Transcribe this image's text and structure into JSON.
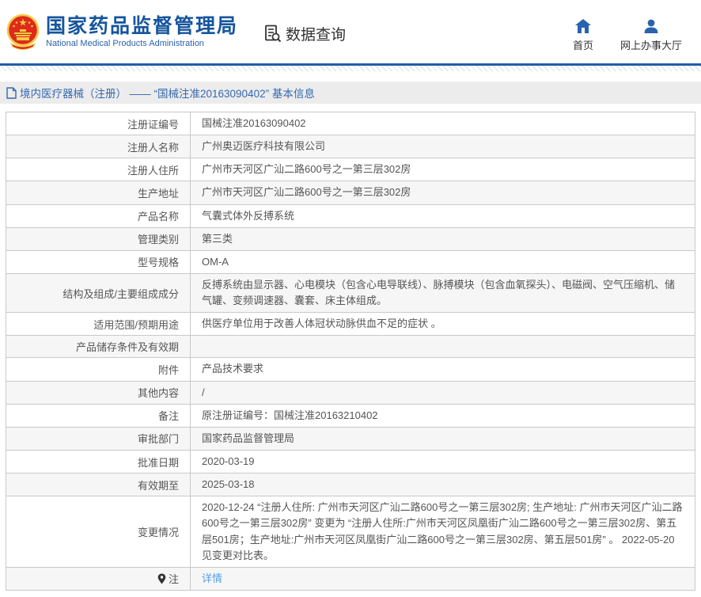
{
  "header": {
    "org_name_cn": "国家药品监督管理局",
    "org_name_en": "National Medical Products Administration",
    "section_title": "数据查询",
    "nav": [
      {
        "label": "首页",
        "icon": "home-icon"
      },
      {
        "label": "网上办事大厅",
        "icon": "user-icon"
      }
    ]
  },
  "breadcrumb": {
    "icon": "document-icon",
    "text": "境内医疗器械（注册） —— “国械注准20163090402” 基本信息"
  },
  "table": {
    "rows": [
      {
        "label": "注册证编号",
        "value": "国械注准20163090402"
      },
      {
        "label": "注册人名称",
        "value": "广州奥迈医疗科技有限公司"
      },
      {
        "label": "注册人住所",
        "value": "广州市天河区广汕二路600号之一第三层302房"
      },
      {
        "label": "生产地址",
        "value": "广州市天河区广汕二路600号之一第三层302房"
      },
      {
        "label": "产品名称",
        "value": "气囊式体外反搏系统"
      },
      {
        "label": "管理类别",
        "value": "第三类"
      },
      {
        "label": "型号规格",
        "value": "OM-A"
      },
      {
        "label": "结构及组成/主要组成成分",
        "value": "反搏系统由显示器、心电模块（包含心电导联线）、脉搏模块（包含血氧探头）、电磁阀、空气压缩机、储 气罐、变频调速器、囊套、床主体组成。"
      },
      {
        "label": "适用范围/预期用途",
        "value": "供医疗单位用于改善人体冠状动脉供血不足的症状 。"
      },
      {
        "label": "产品储存条件及有效期",
        "value": ""
      },
      {
        "label": "附件",
        "value": "产品技术要求"
      },
      {
        "label": "其他内容",
        "value": "/"
      },
      {
        "label": "备注",
        "value": "原注册证编号：国械注准20163210402"
      },
      {
        "label": "审批部门",
        "value": "国家药品监督管理局"
      },
      {
        "label": "批准日期",
        "value": "2020-03-19"
      },
      {
        "label": "有效期至",
        "value": "2025-03-18"
      },
      {
        "label": "变更情况",
        "value": "2020-12-24  “注册人住所: 广州市天河区广汕二路600号之一第三层302房; 生产地址: 广州市天河区广汕二路600号之一第三层302房” 变更为 “注册人住所:广州市天河区凤凰街广汕二路600号之一第三层302房、第五层501房；生产地址:广州市天河区凤凰街广汕二路600号之一第三层302房、第五层501房” 。 2022-05-20 见变更对比表。"
      },
      {
        "label": "注",
        "value": "详情",
        "value_is_link": true,
        "label_icon": "pin-icon"
      }
    ]
  },
  "colors": {
    "accent_blue": "#15559e",
    "nav_icon_blue": "#2a63ad",
    "link_blue": "#53a0e8",
    "breadcrumb_blue": "#3568b0",
    "table_border": "#c9c9c9",
    "zebra_row": "#f6f6f6",
    "breadcrumb_bg": "#ececec",
    "emblem_red": "#de2a1b",
    "emblem_gold": "#f2c945"
  }
}
